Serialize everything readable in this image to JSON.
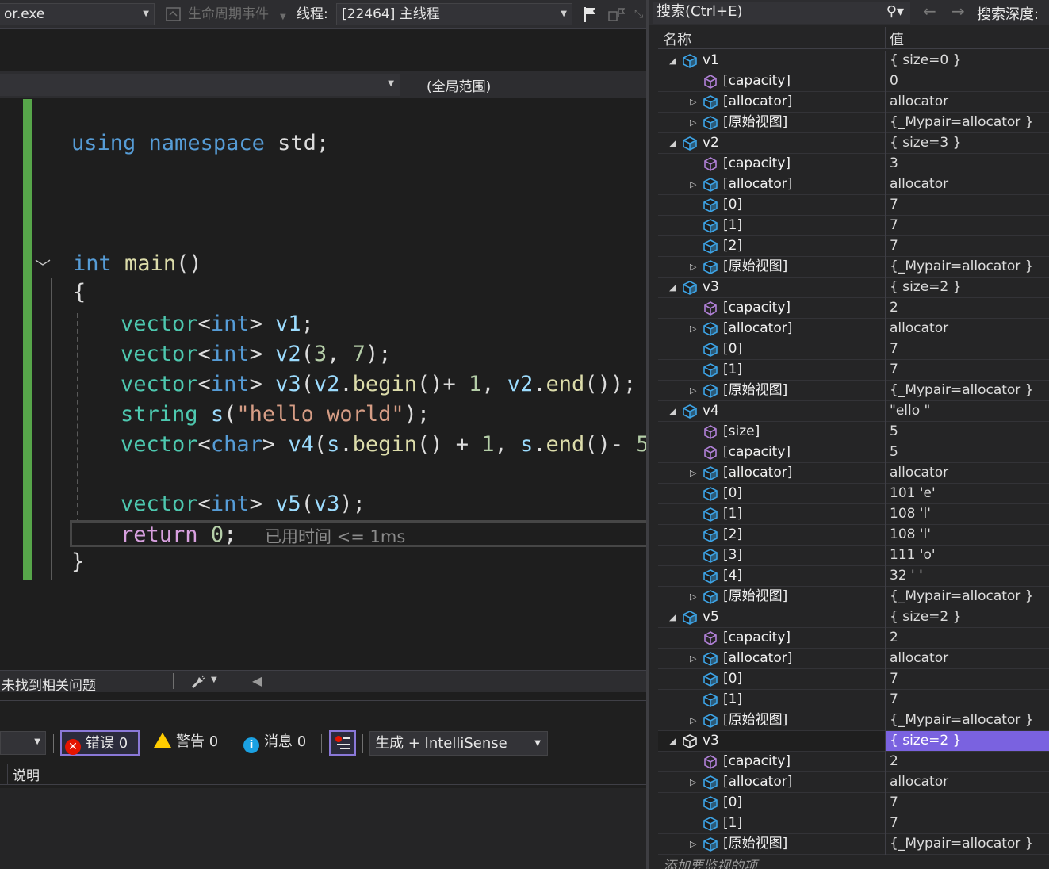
{
  "toolbar": {
    "process": "or.exe",
    "lifecycle_label": "生命周期事件",
    "thread_label": "线程:",
    "thread_value": "[22464] 主线程"
  },
  "editor": {
    "scope": "(全局范围)",
    "code": {
      "line_using": [
        "using",
        "namespace",
        "std;"
      ],
      "main_kw": "int",
      "main_fn": "main",
      "main_paren": "()",
      "open_brace": "{",
      "close_brace": "}",
      "elapsed": "已用时间 <= 1ms"
    }
  },
  "status": {
    "issues": "未找到相关问题"
  },
  "error_list": {
    "errors": "错误 0",
    "warnings": "警告 0",
    "messages": "消息 0",
    "build_filter": "生成 + IntelliSense",
    "column_description": "说明"
  },
  "watch": {
    "search_placeholder": "搜索(Ctrl+E)",
    "search_depth_label": "搜索深度:",
    "col_name": "名称",
    "col_value": "值",
    "add_item": "添加要监视的项",
    "rows": [
      {
        "name": "v1",
        "value": "{ size=0 }",
        "level": 0,
        "expander": "expanded",
        "icon": "cube"
      },
      {
        "name": "[capacity]",
        "value": "0",
        "level": 1,
        "expander": "none",
        "icon": "prop"
      },
      {
        "name": "[allocator]",
        "value": "allocator",
        "level": 1,
        "expander": "collapsed",
        "icon": "cube"
      },
      {
        "name": "[原始视图]",
        "value": "{_Mypair=allocator }",
        "level": 1,
        "expander": "collapsed",
        "icon": "cube"
      },
      {
        "name": "v2",
        "value": "{ size=3 }",
        "level": 0,
        "expander": "expanded",
        "icon": "cube"
      },
      {
        "name": "[capacity]",
        "value": "3",
        "level": 1,
        "expander": "none",
        "icon": "prop"
      },
      {
        "name": "[allocator]",
        "value": "allocator",
        "level": 1,
        "expander": "collapsed",
        "icon": "cube"
      },
      {
        "name": "[0]",
        "value": "7",
        "level": 1,
        "expander": "none",
        "icon": "cube"
      },
      {
        "name": "[1]",
        "value": "7",
        "level": 1,
        "expander": "none",
        "icon": "cube"
      },
      {
        "name": "[2]",
        "value": "7",
        "level": 1,
        "expander": "none",
        "icon": "cube"
      },
      {
        "name": "[原始视图]",
        "value": "{_Mypair=allocator }",
        "level": 1,
        "expander": "collapsed",
        "icon": "cube"
      },
      {
        "name": "v3",
        "value": "{ size=2 }",
        "level": 0,
        "expander": "expanded",
        "icon": "cube"
      },
      {
        "name": "[capacity]",
        "value": "2",
        "level": 1,
        "expander": "none",
        "icon": "prop"
      },
      {
        "name": "[allocator]",
        "value": "allocator",
        "level": 1,
        "expander": "collapsed",
        "icon": "cube"
      },
      {
        "name": "[0]",
        "value": "7",
        "level": 1,
        "expander": "none",
        "icon": "cube"
      },
      {
        "name": "[1]",
        "value": "7",
        "level": 1,
        "expander": "none",
        "icon": "cube"
      },
      {
        "name": "[原始视图]",
        "value": "{_Mypair=allocator }",
        "level": 1,
        "expander": "collapsed",
        "icon": "cube"
      },
      {
        "name": "v4",
        "value": "\"ello \"",
        "level": 0,
        "expander": "expanded",
        "icon": "cube"
      },
      {
        "name": "[size]",
        "value": "5",
        "level": 1,
        "expander": "none",
        "icon": "prop"
      },
      {
        "name": "[capacity]",
        "value": "5",
        "level": 1,
        "expander": "none",
        "icon": "prop"
      },
      {
        "name": "[allocator]",
        "value": "allocator",
        "level": 1,
        "expander": "collapsed",
        "icon": "cube"
      },
      {
        "name": "[0]",
        "value": "101 'e'",
        "level": 1,
        "expander": "none",
        "icon": "cube"
      },
      {
        "name": "[1]",
        "value": "108 'l'",
        "level": 1,
        "expander": "none",
        "icon": "cube"
      },
      {
        "name": "[2]",
        "value": "108 'l'",
        "level": 1,
        "expander": "none",
        "icon": "cube"
      },
      {
        "name": "[3]",
        "value": "111 'o'",
        "level": 1,
        "expander": "none",
        "icon": "cube"
      },
      {
        "name": "[4]",
        "value": "32 ' '",
        "level": 1,
        "expander": "none",
        "icon": "cube"
      },
      {
        "name": "[原始视图]",
        "value": "{_Mypair=allocator }",
        "level": 1,
        "expander": "collapsed",
        "icon": "cube"
      },
      {
        "name": "v5",
        "value": "{ size=2 }",
        "level": 0,
        "expander": "expanded",
        "icon": "cube"
      },
      {
        "name": "[capacity]",
        "value": "2",
        "level": 1,
        "expander": "none",
        "icon": "prop"
      },
      {
        "name": "[allocator]",
        "value": "allocator",
        "level": 1,
        "expander": "collapsed",
        "icon": "cube"
      },
      {
        "name": "[0]",
        "value": "7",
        "level": 1,
        "expander": "none",
        "icon": "cube"
      },
      {
        "name": "[1]",
        "value": "7",
        "level": 1,
        "expander": "none",
        "icon": "cube"
      },
      {
        "name": "[原始视图]",
        "value": "{_Mypair=allocator }",
        "level": 1,
        "expander": "collapsed",
        "icon": "cube"
      },
      {
        "name": "v3",
        "value": "{ size=2 }",
        "level": 0,
        "expander": "expanded",
        "icon": "cube",
        "selected": true
      },
      {
        "name": "[capacity]",
        "value": "2",
        "level": 1,
        "expander": "none",
        "icon": "prop"
      },
      {
        "name": "[allocator]",
        "value": "allocator",
        "level": 1,
        "expander": "collapsed",
        "icon": "cube"
      },
      {
        "name": "[0]",
        "value": "7",
        "level": 1,
        "expander": "none",
        "icon": "cube"
      },
      {
        "name": "[1]",
        "value": "7",
        "level": 1,
        "expander": "none",
        "icon": "cube"
      },
      {
        "name": "[原始视图]",
        "value": "{_Mypair=allocator }",
        "level": 1,
        "expander": "collapsed",
        "icon": "cube"
      }
    ]
  },
  "colors": {
    "accent": "#7a62e0",
    "change_bar": "#57a64a",
    "keyword": "#569cd6",
    "type": "#4ec9b0",
    "string": "#d69d85"
  }
}
